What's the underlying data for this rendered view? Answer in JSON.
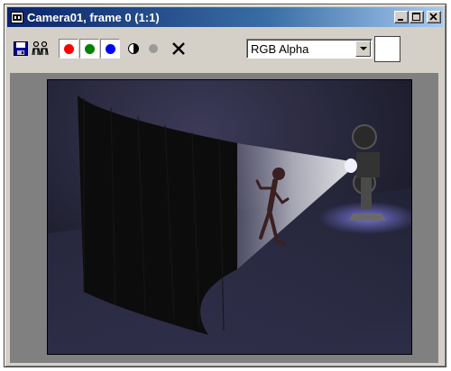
{
  "window": {
    "title": "Camera01, frame 0 (1:1)",
    "icon": "render-window-icon",
    "buttons": [
      "minimize-icon",
      "maximize-icon",
      "close-icon"
    ]
  },
  "toolbar": {
    "save_icon": "floppy-disk-icon",
    "clone_icon": "clone-window-icon",
    "channels": [
      {
        "name": "red-channel",
        "color": "#ff0000"
      },
      {
        "name": "green-channel",
        "color": "#008000"
      },
      {
        "name": "blue-channel",
        "color": "#0000ff"
      }
    ],
    "mono_icon": "monochrome-icon",
    "alpha_dot_icon": "alpha-toggle-icon",
    "clear_icon": "clear-x-icon",
    "display_mode": "RGB Alpha",
    "swatch_color": "#ffffff"
  },
  "render": {
    "background": "#14141e",
    "scene": "projector-screen-render"
  }
}
